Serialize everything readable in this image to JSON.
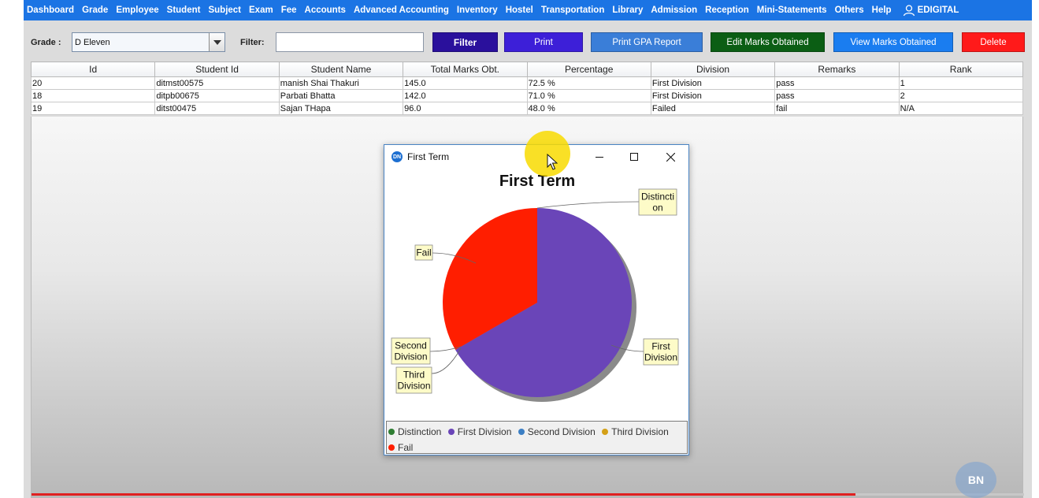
{
  "menu": [
    "Dashboard",
    "Grade",
    "Employee",
    "Student",
    "Subject",
    "Exam",
    "Fee",
    "Accounts",
    "Advanced Accounting",
    "Inventory",
    "Hostel",
    "Transportation",
    "Library",
    "Admission",
    "Reception",
    "Mini-Statements",
    "Others",
    "Help"
  ],
  "user": "EDIGITAL",
  "toolbar": {
    "grade_label": "Grade :",
    "grade_value": "D Eleven",
    "filter_label": "Filter:",
    "filter_value": "",
    "buttons": {
      "filter": "Filter",
      "print": "Print",
      "print_gpa": "Print GPA Report",
      "edit_marks": "Edit Marks Obtained",
      "view_marks": "View Marks Obtained",
      "delete": "Delete"
    },
    "colors": {
      "filter": "#2a109c",
      "print": "#3d1fd8",
      "print_gpa": "#3a7ed8",
      "edit_marks": "#0b5e14",
      "view_marks": "#1a7df0",
      "delete": "#ff1a1a"
    }
  },
  "table": {
    "headers": [
      "Id",
      "Student Id",
      "Student Name",
      "Total Marks Obt.",
      "Percentage",
      "Division",
      "Remarks",
      "Rank"
    ],
    "rows": [
      [
        "20",
        "ditmst00575",
        "manish Shai Thakuri",
        "145.0",
        "72.5 %",
        "First Division",
        "pass",
        "1"
      ],
      [
        "18",
        "ditpb00675",
        "Parbati Bhatta",
        "142.0",
        "71.0 %",
        "First Division",
        "pass",
        "2"
      ],
      [
        "19",
        "ditst00475",
        "Sajan THapa",
        "96.0",
        "48.0 %",
        "Failed",
        "fail",
        "N/A"
      ]
    ]
  },
  "dialog": {
    "title": "First Term",
    "icon_text": "DN"
  },
  "chart_data": {
    "type": "pie",
    "title": "First Term",
    "slices": [
      {
        "name": "Distinction",
        "label": "Distincti\non",
        "value": 0,
        "color": "#2e7d32"
      },
      {
        "name": "First Division",
        "label": "First\nDivision",
        "value": 2,
        "color": "#6a45b8"
      },
      {
        "name": "Second Division",
        "label": "Second\nDivision",
        "value": 0,
        "color": "#3c7fc4"
      },
      {
        "name": "Third Division",
        "label": "Third\nDivision",
        "value": 0,
        "color": "#d4a017"
      },
      {
        "name": "Fail",
        "label": "Fail",
        "value": 1,
        "color": "#ff1e00"
      }
    ],
    "legend_position": "bottom"
  },
  "progress": 0.83,
  "watermark": "BN"
}
